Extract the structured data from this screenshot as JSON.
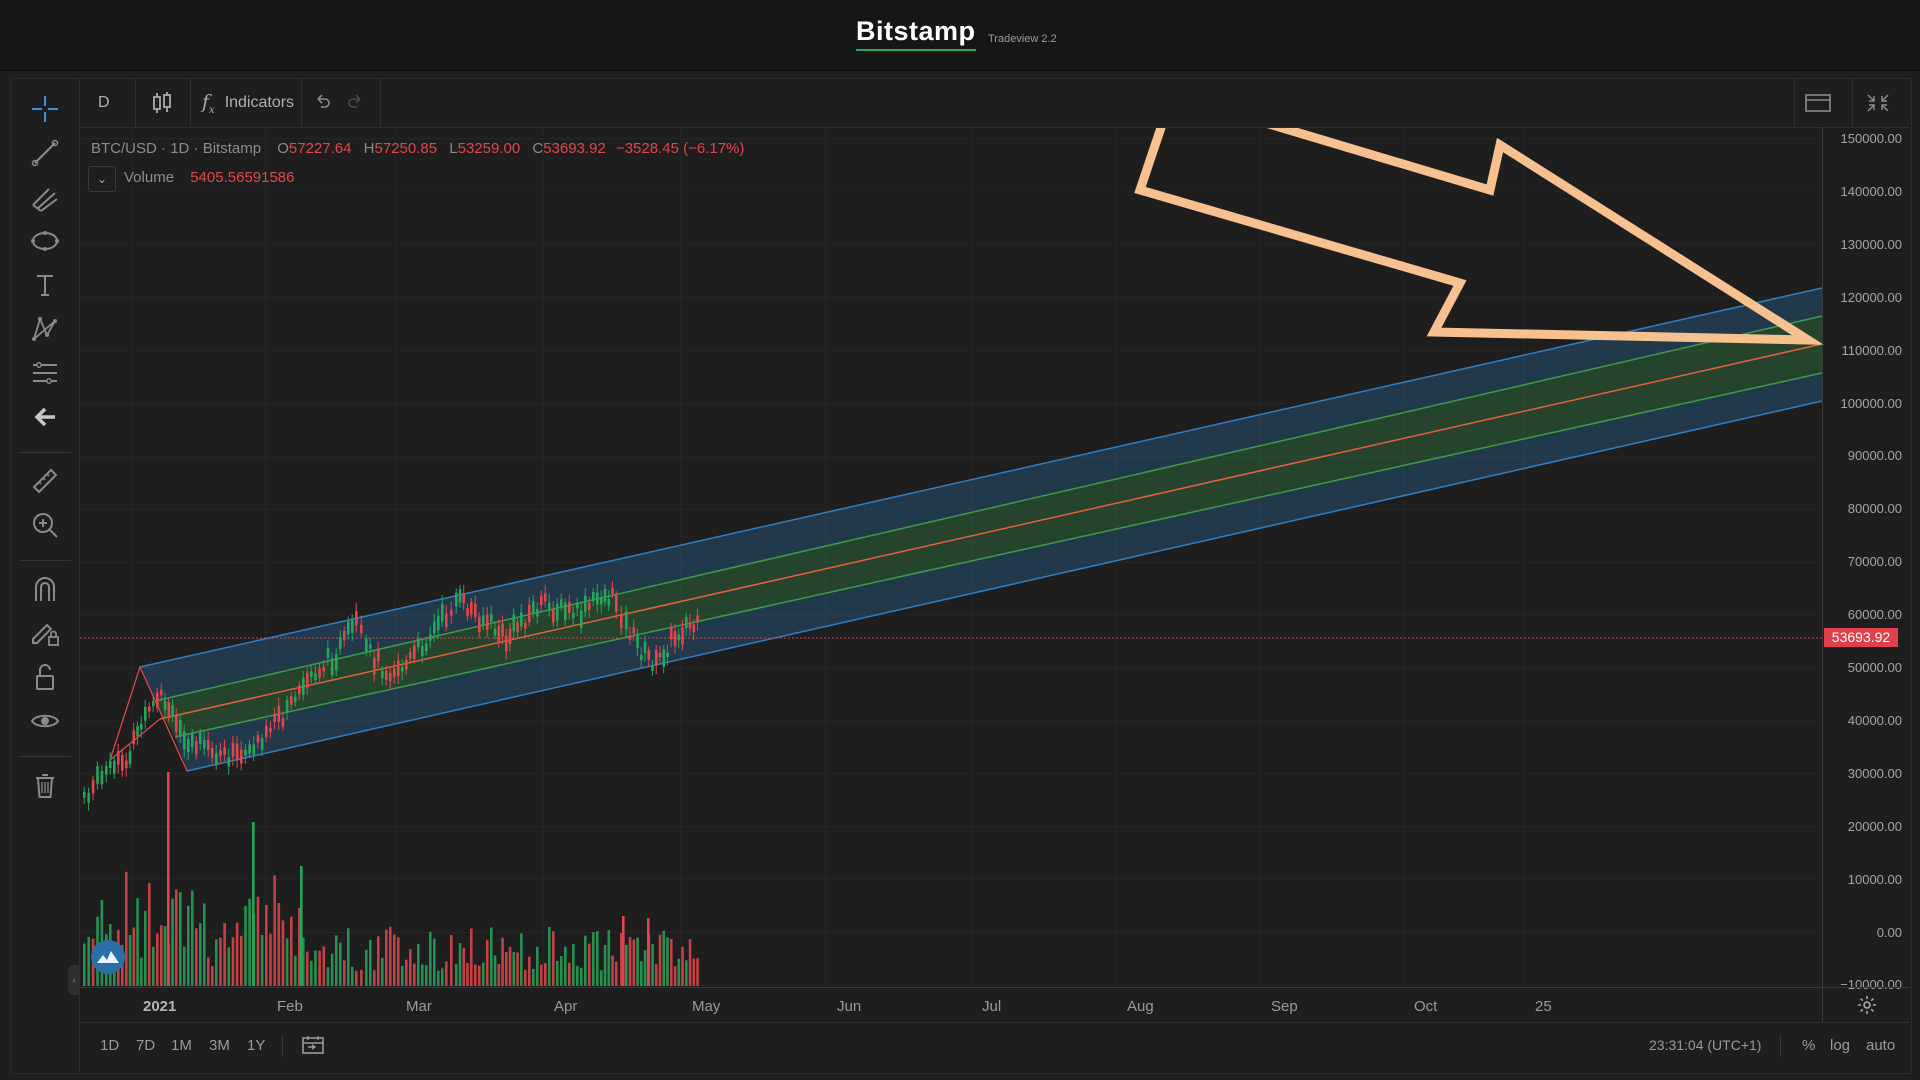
{
  "header": {
    "brand": "Bitstamp",
    "version": "Tradeview 2.2"
  },
  "toolbar": {
    "interval": "D",
    "indicators_label": "Indicators"
  },
  "legend": {
    "symbol": "BTC/USD",
    "interval": "1D",
    "exchange": "Bitstamp",
    "sep": "·",
    "o_label": "O",
    "open": "57227.64",
    "h_label": "H",
    "high": "57250.85",
    "l_label": "L",
    "low": "53259.00",
    "c_label": "C",
    "close": "53693.92",
    "change": "−3528.45 (−6.17%)",
    "volume_label": "Volume",
    "volume_value": "5405.56591586"
  },
  "price_axis": {
    "ticks": [
      "150000.00",
      "140000.00",
      "130000.00",
      "120000.00",
      "110000.00",
      "100000.00",
      "90000.00",
      "80000.00",
      "70000.00",
      "60000.00",
      "50000.00",
      "40000.00",
      "30000.00",
      "20000.00",
      "10000.00",
      "0.00",
      "−10000.00"
    ],
    "last_price": "53693.92"
  },
  "time_axis": {
    "ticks": [
      "2021",
      "Feb",
      "Mar",
      "Apr",
      "May",
      "Jun",
      "Jul",
      "Aug",
      "Sep",
      "Oct",
      "25"
    ]
  },
  "bottom": {
    "ranges": [
      "1D",
      "7D",
      "1M",
      "3M",
      "1Y"
    ],
    "clock": "23:31:04 (UTC+1)",
    "pct": "%",
    "log": "log",
    "auto": "auto"
  },
  "colors": {
    "up": "#26a65b",
    "down": "#e0474c",
    "channel_outer": "#2f7fc1",
    "channel_inner": "#3d9a4f",
    "channel_mid": "#e0623a",
    "arrow": "#f6c08f",
    "price_line": "#e0404a"
  },
  "icons": {
    "left_tools": [
      "crosshair-icon",
      "trend-line-icon",
      "pitchfork-icon",
      "ellipse-icon",
      "text-icon",
      "pattern-icon",
      "fib-icon",
      "arrow-left-icon",
      "ruler-icon",
      "zoom-in-icon",
      "magnet-icon",
      "lock-pencil-icon",
      "unlock-icon",
      "eye-icon",
      "trash-icon"
    ],
    "top_tools": [
      "candles-icon",
      "fx-icon",
      "undo-icon",
      "redo-icon",
      "layout-icon",
      "fullscreen-icon"
    ]
  }
}
